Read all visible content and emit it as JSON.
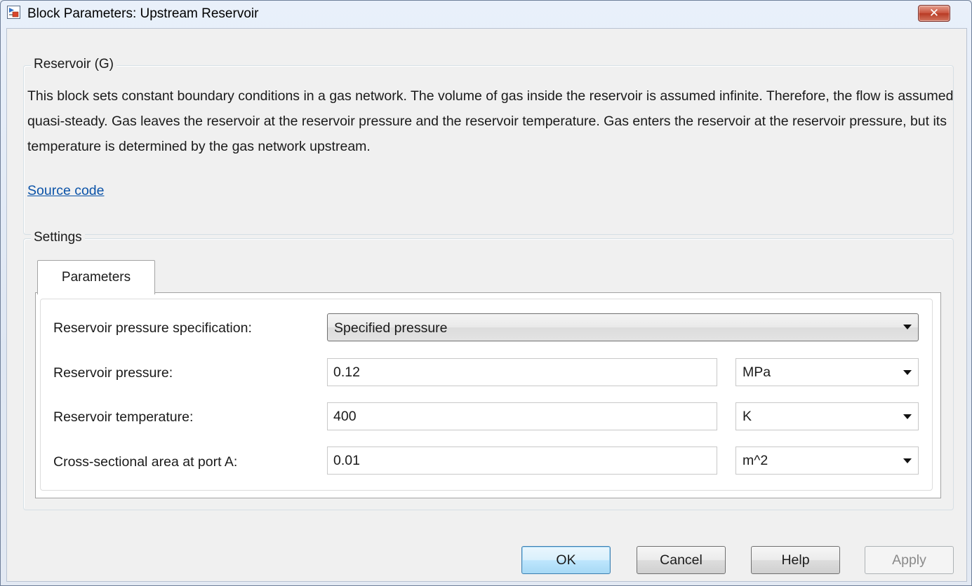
{
  "window": {
    "title": "Block Parameters: Upstream Reservoir",
    "close_glyph": "✕"
  },
  "description_group": {
    "legend": "Reservoir (G)",
    "text": "This block sets constant boundary conditions in a gas network. The volume of gas inside the reservoir is assumed infinite. Therefore, the flow is assumed quasi-steady. Gas leaves the reservoir at the reservoir pressure and the reservoir temperature. Gas enters the reservoir at the reservoir pressure, but its temperature is determined by the gas network upstream.",
    "link_label": "Source code"
  },
  "settings": {
    "legend": "Settings",
    "tabs": [
      {
        "label": "Parameters",
        "selected": true
      }
    ],
    "fields": [
      {
        "label": "Reservoir pressure specification:",
        "type": "select",
        "value": "Specified pressure"
      },
      {
        "label": "Reservoir pressure:",
        "type": "input",
        "value": "0.12",
        "unit": "MPa"
      },
      {
        "label": "Reservoir temperature:",
        "type": "input",
        "value": "400",
        "unit": "K"
      },
      {
        "label": "Cross-sectional area at port A:",
        "type": "input",
        "value": "0.01",
        "unit": "m^2"
      }
    ]
  },
  "buttons": {
    "ok": "OK",
    "cancel": "Cancel",
    "help": "Help",
    "apply": "Apply"
  },
  "icons": {
    "app": "simulink-block-icon",
    "close": "close-icon",
    "dropdown": "chevron-down-icon"
  },
  "colors": {
    "link": "#0b53a8",
    "close_button": "#c8503b",
    "default_button": "#bee6fd"
  }
}
